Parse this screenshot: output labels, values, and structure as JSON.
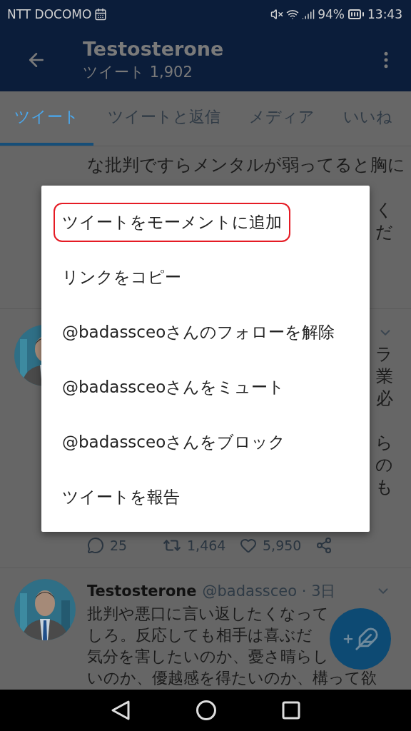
{
  "status_bar": {
    "carrier": "NTT DOCOMO",
    "battery": "94%",
    "time": "13:43"
  },
  "header": {
    "title": "Testosterone",
    "subtitle": "ツイート 1,902"
  },
  "tabs": [
    {
      "label": "ツイート",
      "selected": true
    },
    {
      "label": "ツイートと返信",
      "selected": false
    },
    {
      "label": "メディア",
      "selected": false
    },
    {
      "label": "いいね",
      "selected": false
    }
  ],
  "tweets": [
    {
      "lines": [
        "な批判ですらメンタルが弱ってると胸に"
      ],
      "fragments": [
        "く",
        "だ"
      ]
    },
    {
      "fragments": [
        "ラ",
        "業",
        "必",
        "ら",
        "の",
        "も"
      ],
      "replies": "25",
      "retweets": "1,464",
      "likes": "5,950"
    },
    {
      "name": "Testosterone",
      "meta": "@badassceo · 3日",
      "lines": [
        "批判や悪口に言い返したくなって",
        "しろ。反応しても相手は喜ぶだ",
        "気分を害したいのか、憂さ晴らし",
        "いのか、優越感を得たいのか、構って欲"
      ]
    }
  ],
  "menu": {
    "items": [
      {
        "label": "ツイートをモーメントに追加",
        "highlighted": true
      },
      {
        "label": "リンクをコピー",
        "highlighted": false
      },
      {
        "label": "@badassceoさんのフォローを解除",
        "highlighted": false
      },
      {
        "label": "@badassceoさんをミュート",
        "highlighted": false
      },
      {
        "label": "@badassceoさんをブロック",
        "highlighted": false
      },
      {
        "label": "ツイートを報告",
        "highlighted": false
      }
    ]
  }
}
